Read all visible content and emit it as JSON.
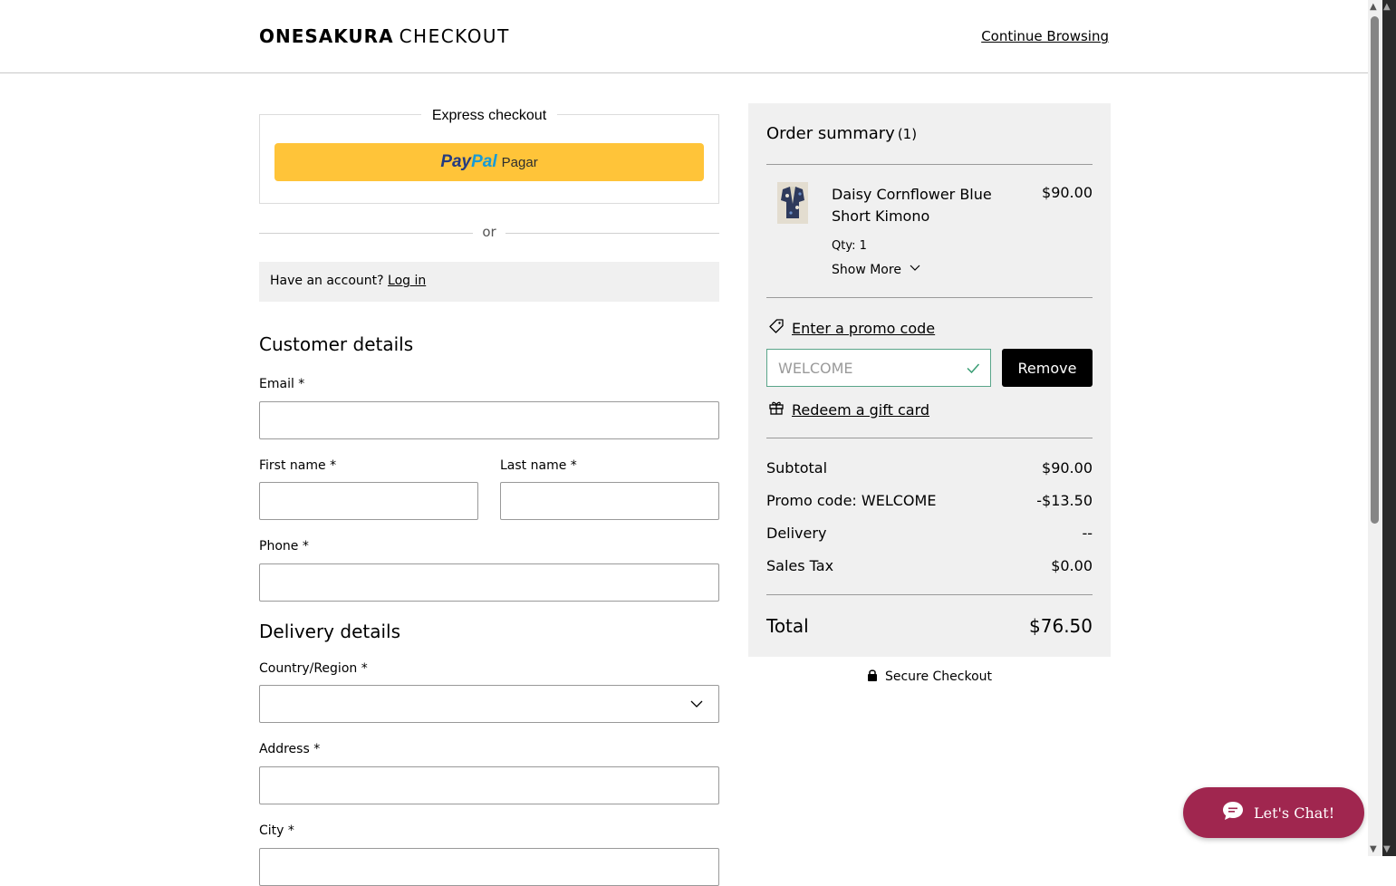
{
  "header": {
    "brand_name": "ONESAKURA",
    "brand_sub": "CHECKOUT",
    "continue_label": "Continue Browsing"
  },
  "express": {
    "title": "Express checkout",
    "paypal_pay": "Pay",
    "paypal_pal": "Pal",
    "paypal_action": "Pagar",
    "paypal_color": "#ffc439"
  },
  "separator": {
    "or": "or"
  },
  "account": {
    "prompt": "Have an account?",
    "login_label": "Log in"
  },
  "customer": {
    "title": "Customer details",
    "email_label": "Email *",
    "first_name_label": "First name *",
    "last_name_label": "Last name *",
    "phone_label": "Phone *"
  },
  "delivery": {
    "title": "Delivery details",
    "country_label": "Country/Region *",
    "address_label": "Address *",
    "city_label": "City *"
  },
  "summary": {
    "title": "Order summary",
    "count": "(1)",
    "item": {
      "name": "Daisy Cornflower Blue Short Kimono",
      "price": "$90.00",
      "qty": "Qty: 1",
      "show_more": "Show More"
    },
    "promo_link": "Enter a promo code",
    "promo_value": "WELCOME",
    "remove_label": "Remove",
    "gift_link": "Redeem a gift card",
    "subtotal_label": "Subtotal",
    "subtotal_value": "$90.00",
    "promo_label": "Promo code: WELCOME",
    "promo_discount": "-$13.50",
    "delivery_label": "Delivery",
    "delivery_value": "--",
    "tax_label": "Sales Tax",
    "tax_value": "$0.00",
    "total_label": "Total",
    "total_value": "$76.50"
  },
  "secure": {
    "label": "Secure Checkout"
  },
  "chat": {
    "label": "Let's Chat!",
    "color": "#a0264f"
  }
}
